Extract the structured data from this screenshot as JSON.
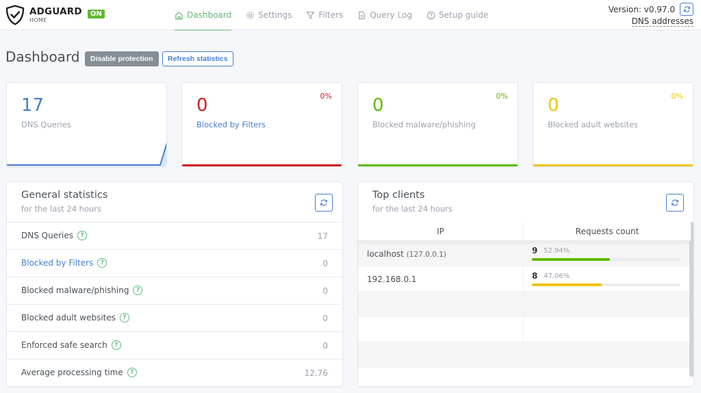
{
  "header": {
    "brand": "ADGUARD",
    "brand_sub": "HOME",
    "status_badge": "ON",
    "nav": [
      {
        "label": "Dashboard",
        "icon": "home-icon",
        "active": true
      },
      {
        "label": "Settings",
        "icon": "gear-icon",
        "active": false
      },
      {
        "label": "Filters",
        "icon": "filter-icon",
        "active": false
      },
      {
        "label": "Query Log",
        "icon": "document-icon",
        "active": false
      },
      {
        "label": "Setup guide",
        "icon": "help-circle-icon",
        "active": false
      }
    ],
    "version": "Version: v0.97.0",
    "dns_addresses": "DNS addresses"
  },
  "page": {
    "title": "Dashboard",
    "disable_protection": "Disable protection",
    "refresh_statistics": "Refresh statistics"
  },
  "stat_cards": [
    {
      "value": "17",
      "label": "DNS Queries",
      "percent": "",
      "color": "#467fcf"
    },
    {
      "value": "0",
      "label": "Blocked by Filters",
      "percent": "0%",
      "color": "#cd201f"
    },
    {
      "value": "0",
      "label": "Blocked malware/phishing",
      "percent": "0%",
      "color": "#5eba00"
    },
    {
      "value": "0",
      "label": "Blocked adult websites",
      "percent": "0%",
      "color": "#f1c40f"
    }
  ],
  "general_statistics": {
    "title": "General statistics",
    "subtitle": "for the last 24 hours",
    "rows": [
      {
        "label": "DNS Queries",
        "value": "17"
      },
      {
        "label": "Blocked by Filters",
        "value": "0"
      },
      {
        "label": "Blocked malware/phishing",
        "value": "0"
      },
      {
        "label": "Blocked adult websites",
        "value": "0"
      },
      {
        "label": "Enforced safe search",
        "value": "0"
      },
      {
        "label": "Average processing time",
        "value": "12.76"
      }
    ]
  },
  "top_clients": {
    "title": "Top clients",
    "subtitle": "for the last 24 hours",
    "columns": [
      "IP",
      "Requests count"
    ],
    "rows": [
      {
        "name": "localhost",
        "ip": "(127.0.0.1)",
        "count": "9",
        "percent": "52.94%",
        "fraction": 0.5294,
        "color": "#5eba00"
      },
      {
        "name": "192.168.0.1",
        "ip": "",
        "count": "8",
        "percent": "47.06%",
        "fraction": 0.4706,
        "color": "#f1c40f"
      }
    ]
  }
}
